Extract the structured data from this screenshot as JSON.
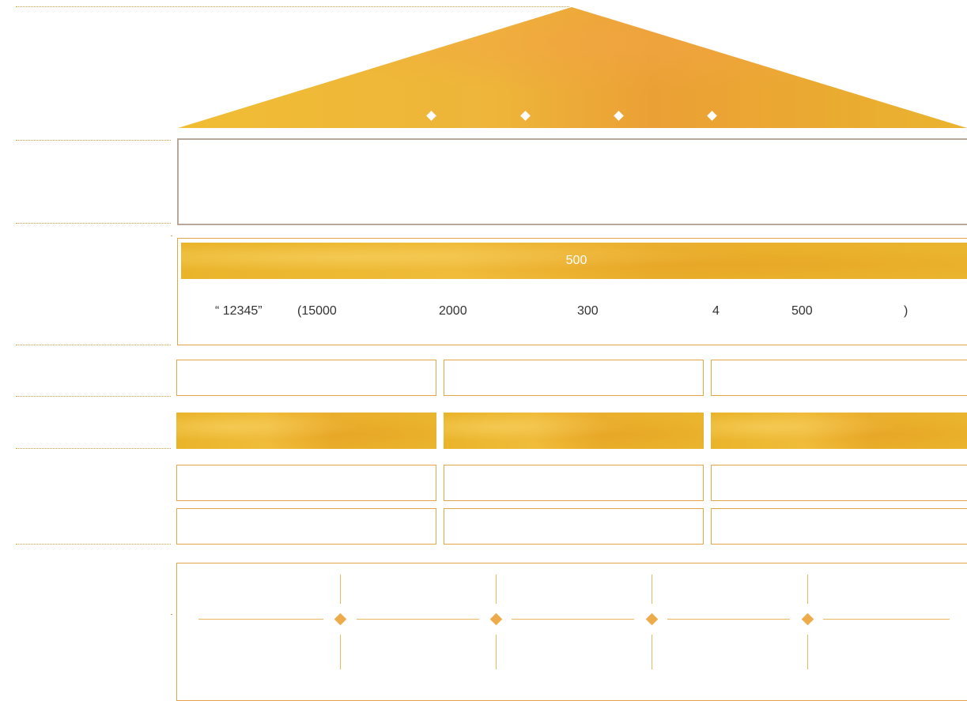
{
  "banner": {
    "label": "500"
  },
  "numbers_row": {
    "code": "“ 12345”",
    "a": "(15000",
    "b": "2000",
    "c": "300",
    "d": "4",
    "e": "500",
    "close": ")"
  },
  "colors": {
    "gold": "#eab42a",
    "outline": "#e2a548",
    "title_border": "#b9a89a",
    "connector": "#eab660"
  }
}
